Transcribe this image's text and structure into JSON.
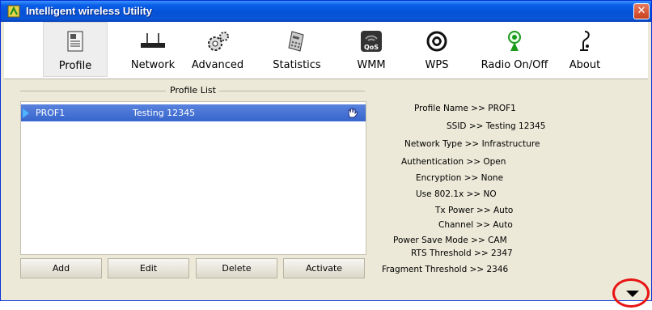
{
  "window": {
    "title": "Intelligent wireless Utility",
    "close_glyph": "✕"
  },
  "toolbar": {
    "items": [
      {
        "label": "Profile",
        "icon": "profile-icon"
      },
      {
        "label": "Network",
        "icon": "network-icon"
      },
      {
        "label": "Advanced",
        "icon": "advanced-icon"
      },
      {
        "label": "Statistics",
        "icon": "statistics-icon"
      },
      {
        "label": "WMM",
        "icon": "wmm-icon"
      },
      {
        "label": "WPS",
        "icon": "wps-icon"
      },
      {
        "label": "Radio On/Off",
        "icon": "radio-icon"
      },
      {
        "label": "About",
        "icon": "about-icon"
      }
    ],
    "selected": "Profile"
  },
  "profile_list": {
    "title": "Profile List",
    "rows": [
      {
        "name": "PROF1",
        "ssid": "Testing 12345"
      }
    ]
  },
  "buttons": {
    "add": "Add",
    "edit": "Edit",
    "delete": "Delete",
    "activate": "Activate"
  },
  "details": [
    "Profile Name >> PROF1",
    "SSID >> Testing 12345",
    "Network Type >> Infrastructure",
    "Authentication >> Open",
    "Encryption >> None",
    "Use 802.1x >> NO",
    "Tx Power >> Auto",
    "Channel >> Auto",
    "Power Save Mode >> CAM",
    "RTS Threshold >> 2347",
    "Fragment Threshold >> 2346"
  ],
  "colors": {
    "title_bar": "#0552d6",
    "selected_row": "#3765cc",
    "highlight_circle": "#e81414"
  }
}
